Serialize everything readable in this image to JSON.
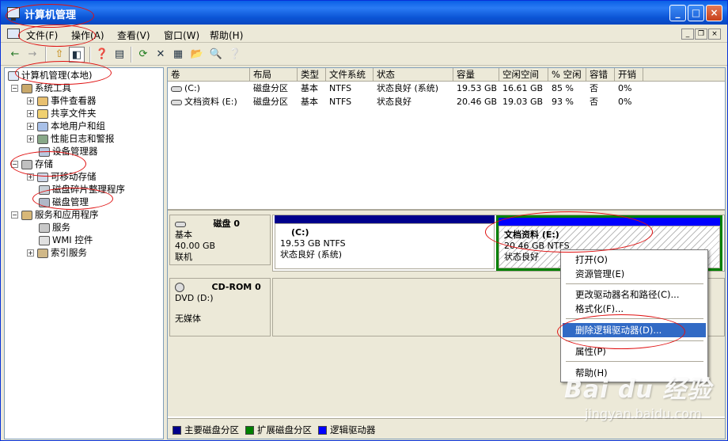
{
  "window": {
    "title": "计算机管理",
    "controls": {
      "minimize": "_",
      "maximize": "□",
      "close": "×"
    }
  },
  "menubar": {
    "items": [
      "文件(F)",
      "操作(A)",
      "查看(V)",
      "窗口(W)",
      "帮助(H)"
    ],
    "mdi": {
      "minimize": "_",
      "restore": "❐",
      "close": "×"
    }
  },
  "toolbar": {
    "icons": [
      "back-icon",
      "forward-icon",
      "up-folder-icon",
      "show-tree-icon",
      "properties-icon",
      "export-list-icon",
      "refresh-icon",
      "delete-icon",
      "property-sheet-icon",
      "open-icon",
      "search-icon",
      "help-icon"
    ],
    "glyphs": {
      "back": "←",
      "forward": "→",
      "up": "⇧",
      "tree": "◧",
      "props": "❓",
      "export": "▤",
      "refresh": "⟳",
      "delete": "✕",
      "sheet": "▦",
      "open": "📂",
      "search": "🔍",
      "help": "❔"
    }
  },
  "tree": {
    "root": "计算机管理(本地)",
    "system_tools": {
      "label": "系统工具",
      "children": [
        "事件查看器",
        "共享文件夹",
        "本地用户和组",
        "性能日志和警报",
        "设备管理器"
      ]
    },
    "storage": {
      "label": "存储",
      "children": [
        "可移动存储",
        "磁盘碎片整理程序",
        "磁盘管理"
      ]
    },
    "services": {
      "label": "服务和应用程序",
      "children": [
        "服务",
        "WMI 控件",
        "索引服务"
      ]
    }
  },
  "volumes": {
    "columns": [
      "卷",
      "布局",
      "类型",
      "文件系统",
      "状态",
      "容量",
      "空闲空间",
      "% 空闲",
      "容错",
      "开销"
    ],
    "rows": [
      [
        "(C:)",
        "磁盘分区",
        "基本",
        "NTFS",
        "状态良好 (系统)",
        "19.53 GB",
        "16.61 GB",
        "85 %",
        "否",
        "0%"
      ],
      [
        "文档资料 (E:)",
        "磁盘分区",
        "基本",
        "NTFS",
        "状态良好",
        "20.46 GB",
        "19.03 GB",
        "93 %",
        "否",
        "0%"
      ]
    ]
  },
  "disks": [
    {
      "name": "磁盘 0",
      "type": "基本",
      "size": "40.00 GB",
      "status": "联机",
      "partitions": [
        {
          "name": "(C:)",
          "size": "19.53 GB NTFS",
          "status": "状态良好 (系统)"
        },
        {
          "name": "文档资料 (E:)",
          "size": "20.46 GB NTFS",
          "status": "状态良好"
        }
      ]
    },
    {
      "name": "CD-ROM 0",
      "type": "DVD (D:)",
      "status": "无媒体"
    }
  ],
  "legend": [
    {
      "label": "主要磁盘分区",
      "color": "#00008b"
    },
    {
      "label": "扩展磁盘分区",
      "color": "#008000"
    },
    {
      "label": "逻辑驱动器",
      "color": "#0000ff"
    }
  ],
  "context_menu": {
    "items": [
      "打开(O)",
      "资源管理(E)",
      "更改驱动器名和路径(C)...",
      "格式化(F)...",
      "删除逻辑驱动器(D)...",
      "属性(P)",
      "帮助(H)"
    ],
    "highlighted": "删除逻辑驱动器(D)..."
  },
  "watermark": {
    "logo": "Bai du 经验",
    "url": "jingyan.baidu.com"
  },
  "colors": {
    "primary_partition": "#00008b",
    "extended_partition": "#008000",
    "logical_drive": "#0000ff",
    "annotation": "#e01010",
    "menu_highlight": "#316ac5"
  }
}
